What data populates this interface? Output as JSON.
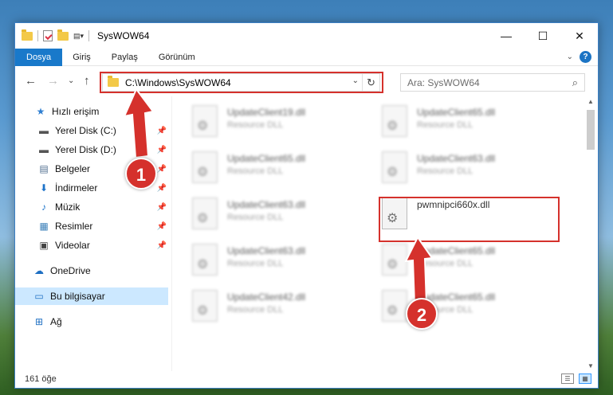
{
  "window": {
    "title": "SysWOW64",
    "minimize": "—",
    "maximize": "☐",
    "close": "✕"
  },
  "ribbon": {
    "tabs": [
      "Dosya",
      "Giriş",
      "Paylaş",
      "Görünüm"
    ],
    "active_tab": "Dosya",
    "help": "?",
    "collapse": "⌄"
  },
  "nav": {
    "back": "←",
    "forward": "→",
    "recent": "⌄",
    "up": "↑"
  },
  "address": {
    "path": "C:\\Windows\\SysWOW64",
    "dropdown": "⌄",
    "refresh": "↻"
  },
  "search": {
    "placeholder": "Ara: SysWOW64",
    "icon": "⌕"
  },
  "sidebar": {
    "items": [
      {
        "label": "Hızlı erişim",
        "icon": "star-icon",
        "glyph": "★",
        "color": "#2f7fd1",
        "pinned": false
      },
      {
        "label": "Yerel Disk (C:)",
        "icon": "drive-icon",
        "glyph": "▬",
        "color": "#555555",
        "pinned": true
      },
      {
        "label": "Yerel Disk (D:)",
        "icon": "drive-icon",
        "glyph": "▬",
        "color": "#555555",
        "pinned": true
      },
      {
        "label": "Belgeler",
        "icon": "documents-icon",
        "glyph": "▤",
        "color": "#4f6e8f",
        "pinned": true
      },
      {
        "label": "İndirmeler",
        "icon": "download-icon",
        "glyph": "⬇",
        "color": "#1d73c9",
        "pinned": true
      },
      {
        "label": "Müzik",
        "icon": "music-icon",
        "glyph": "♪",
        "color": "#1d73c9",
        "pinned": true
      },
      {
        "label": "Resimler",
        "icon": "pictures-icon",
        "glyph": "▦",
        "color": "#3a7fb8",
        "pinned": true
      },
      {
        "label": "Videolar",
        "icon": "videos-icon",
        "glyph": "▣",
        "color": "#444444",
        "pinned": true
      },
      {
        "label": "OneDrive",
        "icon": "onedrive-icon",
        "glyph": "☁",
        "color": "#1e6fc2",
        "pinned": false
      },
      {
        "label": "Bu bilgisayar",
        "icon": "computer-icon",
        "glyph": "▭",
        "color": "#1e6fc2",
        "pinned": false
      },
      {
        "label": "Ağ",
        "icon": "network-icon",
        "glyph": "⊞",
        "color": "#1e6fc2",
        "pinned": false
      }
    ],
    "pin_glyph": "📌"
  },
  "files": [
    {
      "name": "UpdateClient19.dll",
      "type": "Resource DLL",
      "blurred": true
    },
    {
      "name": "UpdateClient65.dll",
      "type": "Resource DLL",
      "blurred": true
    },
    {
      "name": "UpdateClient65.dll",
      "type": "Resource DLL",
      "blurred": true
    },
    {
      "name": "UpdateClient63.dll",
      "type": "Resource DLL",
      "blurred": true
    },
    {
      "name": "UpdateClient63.dll",
      "type": "Resource DLL",
      "blurred": true
    },
    {
      "name": "pwmnipci660x.dll",
      "type": "",
      "blurred": false
    },
    {
      "name": "UpdateClient63.dll",
      "type": "Resource DLL",
      "blurred": true
    },
    {
      "name": "UpdateClient65.dll",
      "type": "Resource DLL",
      "blurred": true
    },
    {
      "name": "UpdateClient42.dll",
      "type": "Resource DLL",
      "blurred": true
    },
    {
      "name": "UpdateClient65.dll",
      "type": "Resource DLL",
      "blurred": true
    }
  ],
  "status": {
    "count": "161 öğe"
  },
  "annotations": {
    "step1": "1",
    "step2": "2",
    "color": "#d5312c"
  }
}
